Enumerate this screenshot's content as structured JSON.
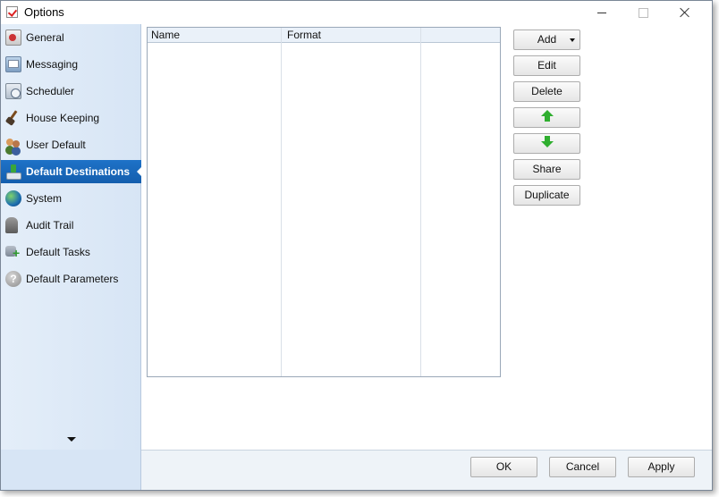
{
  "window": {
    "title": "Options"
  },
  "sidebar": {
    "items": [
      {
        "label": "General",
        "icon": "general-icon",
        "selected": false
      },
      {
        "label": "Messaging",
        "icon": "messaging-icon",
        "selected": false
      },
      {
        "label": "Scheduler",
        "icon": "scheduler-icon",
        "selected": false
      },
      {
        "label": "House Keeping",
        "icon": "broom-icon",
        "selected": false
      },
      {
        "label": "User Default",
        "icon": "users-icon",
        "selected": false
      },
      {
        "label": "Default Destinations",
        "icon": "destination-icon",
        "selected": true
      },
      {
        "label": "System",
        "icon": "globe-icon",
        "selected": false
      },
      {
        "label": "Audit Trail",
        "icon": "audit-icon",
        "selected": false
      },
      {
        "label": "Default Tasks",
        "icon": "tasks-icon",
        "selected": false
      },
      {
        "label": "Default Parameters",
        "icon": "help-icon",
        "selected": false
      }
    ],
    "params_glyph": "?"
  },
  "list": {
    "columns": [
      "Name",
      "Format",
      ""
    ],
    "rows": []
  },
  "actions": {
    "add": "Add",
    "edit": "Edit",
    "delete": "Delete",
    "move_up_icon": "arrow-up-icon",
    "move_down_icon": "arrow-down-icon",
    "share": "Share",
    "duplicate": "Duplicate"
  },
  "footer": {
    "ok": "OK",
    "cancel": "Cancel",
    "apply": "Apply"
  },
  "colors": {
    "selected_bg": "#1e72c8",
    "sidebar_bg": "#dce8f6",
    "arrow_green": "#2fae2f"
  }
}
